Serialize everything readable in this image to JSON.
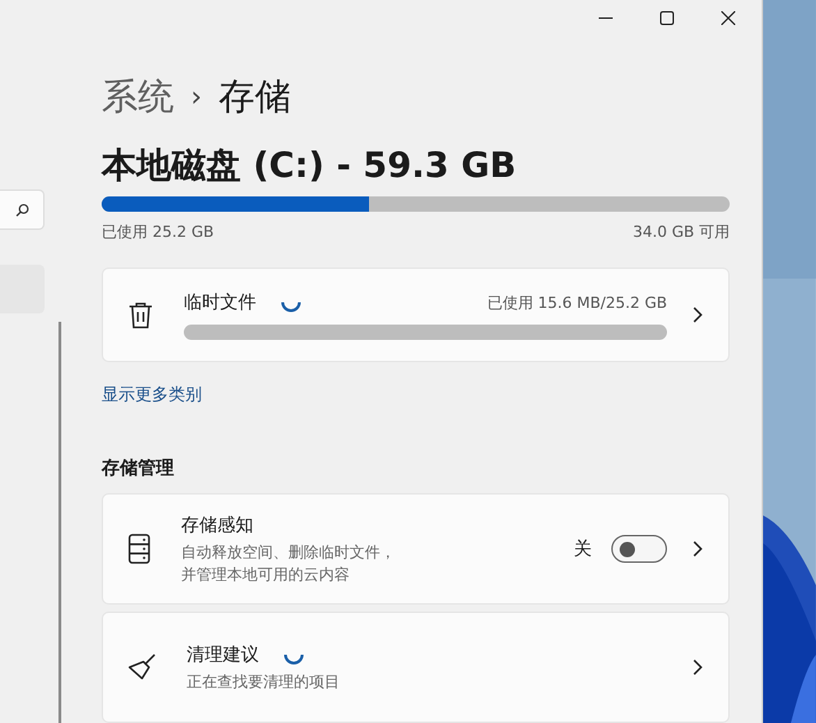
{
  "breadcrumb": {
    "parent": "系统",
    "separator": "›",
    "current": "存储"
  },
  "disk": {
    "title": "本地磁盘 (C:) - 59.3 GB",
    "level": 0.425,
    "used": "已使用 25.2 GB",
    "free": "34.0 GB 可用"
  },
  "categories": [
    {
      "name": "临时文件",
      "loading": true,
      "usage": "已使用 15.6 MB/25.2 GB"
    }
  ],
  "more_link": "显示更多类别",
  "section_title": "存储管理",
  "items": [
    {
      "kind": "toggle",
      "title": "存储感知",
      "loading": false,
      "description": "自动释放空间、删除临时文件，并管理本地可用的云内容",
      "toggle_label": "关",
      "on": false
    },
    {
      "kind": "cleanup",
      "title": "清理建议",
      "loading": true,
      "description": "正在查找要清理的项目"
    }
  ]
}
